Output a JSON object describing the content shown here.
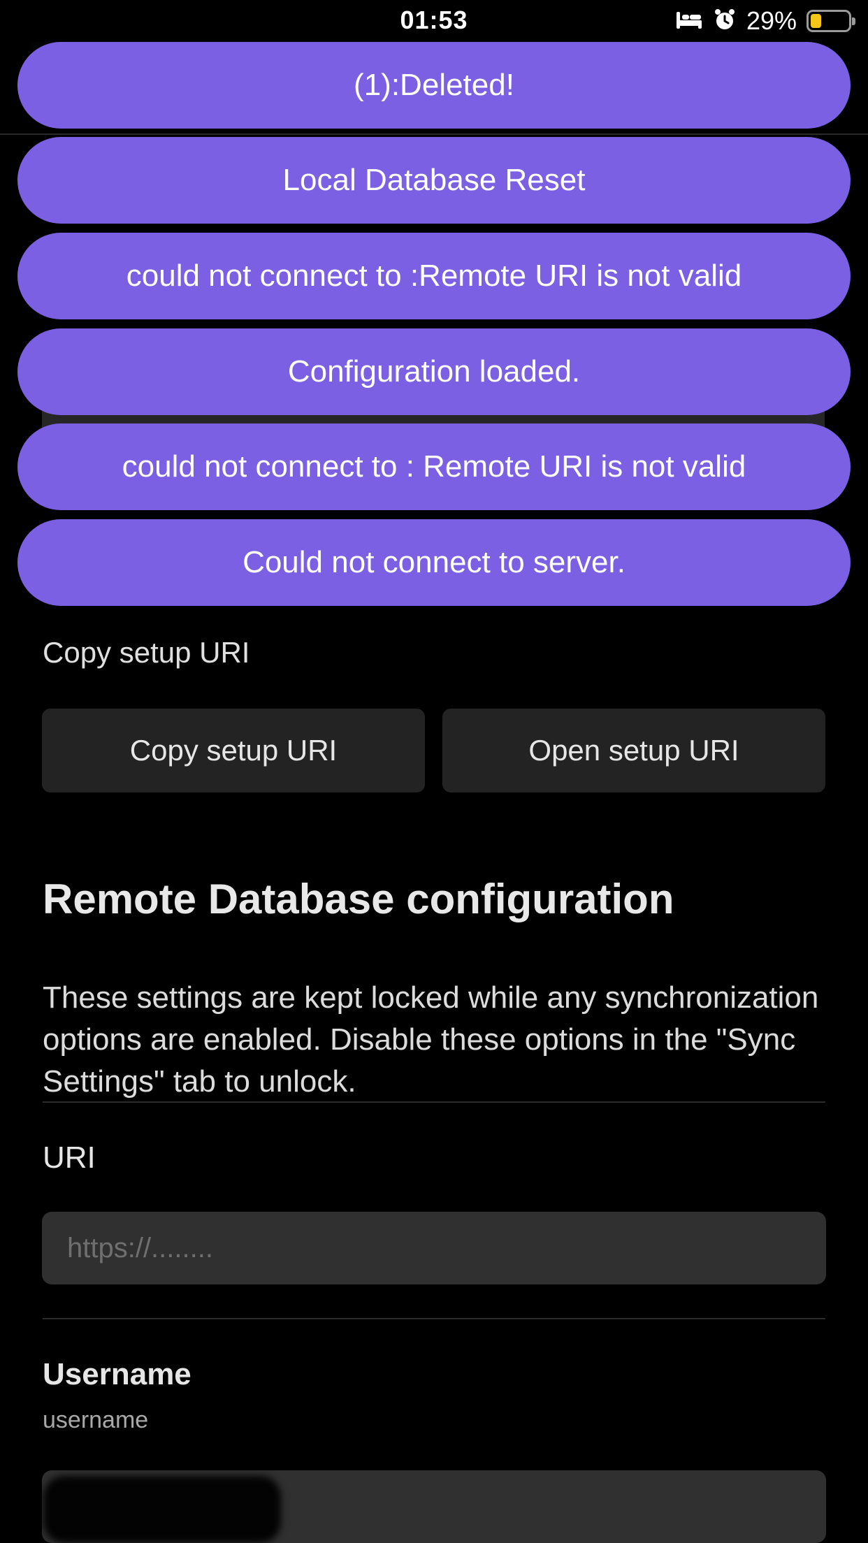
{
  "status_bar": {
    "time": "01:53",
    "battery_percent": "29%",
    "battery_level": 0.29,
    "icons": [
      "bed-icon",
      "alarm-icon",
      "battery-icon"
    ]
  },
  "toasts": [
    "(1):Deleted!",
    "Local Database Reset",
    "could not connect to :Remote URI is not valid",
    "Configuration loaded.",
    "could not connect to : Remote URI is not valid",
    "Could not connect to server."
  ],
  "setup_uri": {
    "section_label": "Copy setup URI",
    "copy_button": "Copy setup URI",
    "open_button": "Open setup URI"
  },
  "remote_db": {
    "heading": "Remote Database configuration",
    "description": "These settings are kept locked while any synchronization options are enabled. Disable these options in the \"Sync Settings\" tab to unlock.",
    "uri_label": "URI",
    "uri_placeholder": "https://........",
    "username_label": "Username",
    "username_sublabel": "username"
  },
  "colors": {
    "toast_bg": "#7b60e3",
    "page_bg": "#000000",
    "button_bg": "#232323",
    "input_bg": "#303030",
    "battery": "#f5c518"
  }
}
